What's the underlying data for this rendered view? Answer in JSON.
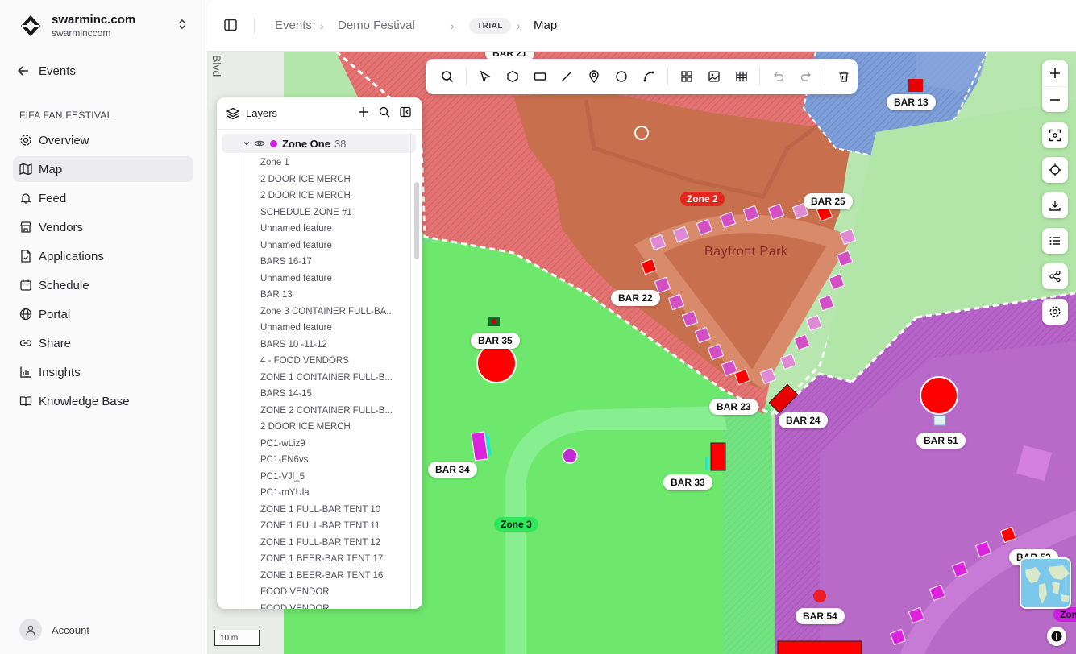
{
  "org": {
    "name": "swarminc.com",
    "sub": "swarminccom"
  },
  "sidebar": {
    "back_label": "Events",
    "section": "FIFA FAN FESTIVAL",
    "items": [
      {
        "label": "Overview",
        "icon": "gear-icon"
      },
      {
        "label": "Map",
        "icon": "map-icon"
      },
      {
        "label": "Feed",
        "icon": "bell-icon"
      },
      {
        "label": "Vendors",
        "icon": "store-icon"
      },
      {
        "label": "Applications",
        "icon": "file-icon"
      },
      {
        "label": "Schedule",
        "icon": "calendar-icon"
      },
      {
        "label": "Portal",
        "icon": "globe-icon"
      },
      {
        "label": "Share",
        "icon": "link-icon"
      },
      {
        "label": "Insights",
        "icon": "chart-icon"
      },
      {
        "label": "Knowledge Base",
        "icon": "book-icon"
      }
    ],
    "account": "Account"
  },
  "header": {
    "crumb1": "Events",
    "crumb2": "Demo Festival",
    "badge": "TRIAL",
    "current": "Map"
  },
  "layers": {
    "title": "Layers",
    "root": {
      "name": "Zone One",
      "count": "38",
      "color": "#d11ee6"
    },
    "items": [
      "Zone 1",
      "2 DOOR ICE MERCH",
      "2 DOOR ICE MERCH",
      "SCHEDULE ZONE #1",
      "Unnamed feature",
      "Unnamed feature",
      "BARS 16-17",
      "Unnamed feature",
      "BAR 13",
      "Zone 3 CONTAINER FULL-BA...",
      "Unnamed feature",
      "BARS 10 -11-12",
      "4 - FOOD VENDORS",
      "ZONE 1 CONTAINER FULL-B...",
      "BARS 14-15",
      "ZONE 2 CONTAINER FULL-B...",
      "2 DOOR ICE MERCH",
      "PC1-wLiz9",
      "PC1-FN6vs",
      "PC1-VJl_5",
      "PC1-mYUla",
      "ZONE 1 FULL-BAR TENT 10",
      "ZONE 1 FULL-BAR TENT 11",
      "ZONE 1 FULL-BAR TENT 12",
      "ZONE 1 BEER-BAR TENT 17",
      "ZONE 1 BEER-BAR TENT 16",
      "FOOD VENDOR",
      "FOOD VENDOR"
    ]
  },
  "map": {
    "street": "Blvd",
    "park": "Bayfront Park",
    "zone2": "Zone 2",
    "zone3": "Zone 3",
    "zone_partial": "Zon",
    "scale": "10 m",
    "labels": {
      "bar21": "BAR 21",
      "bar13": "BAR 13",
      "bar25": "BAR 25",
      "bar22": "BAR 22",
      "bar35": "BAR 35",
      "bar23": "BAR 23",
      "bar24": "BAR 24",
      "bar51": "BAR 51",
      "bar34": "BAR 34",
      "bar33": "BAR 33",
      "bar52": "BAR 52",
      "bar54": "BAR 54"
    },
    "colors": {
      "zone1": "#d11ee6",
      "zone2": "#e0281e",
      "zone3": "#2ee85a"
    }
  }
}
